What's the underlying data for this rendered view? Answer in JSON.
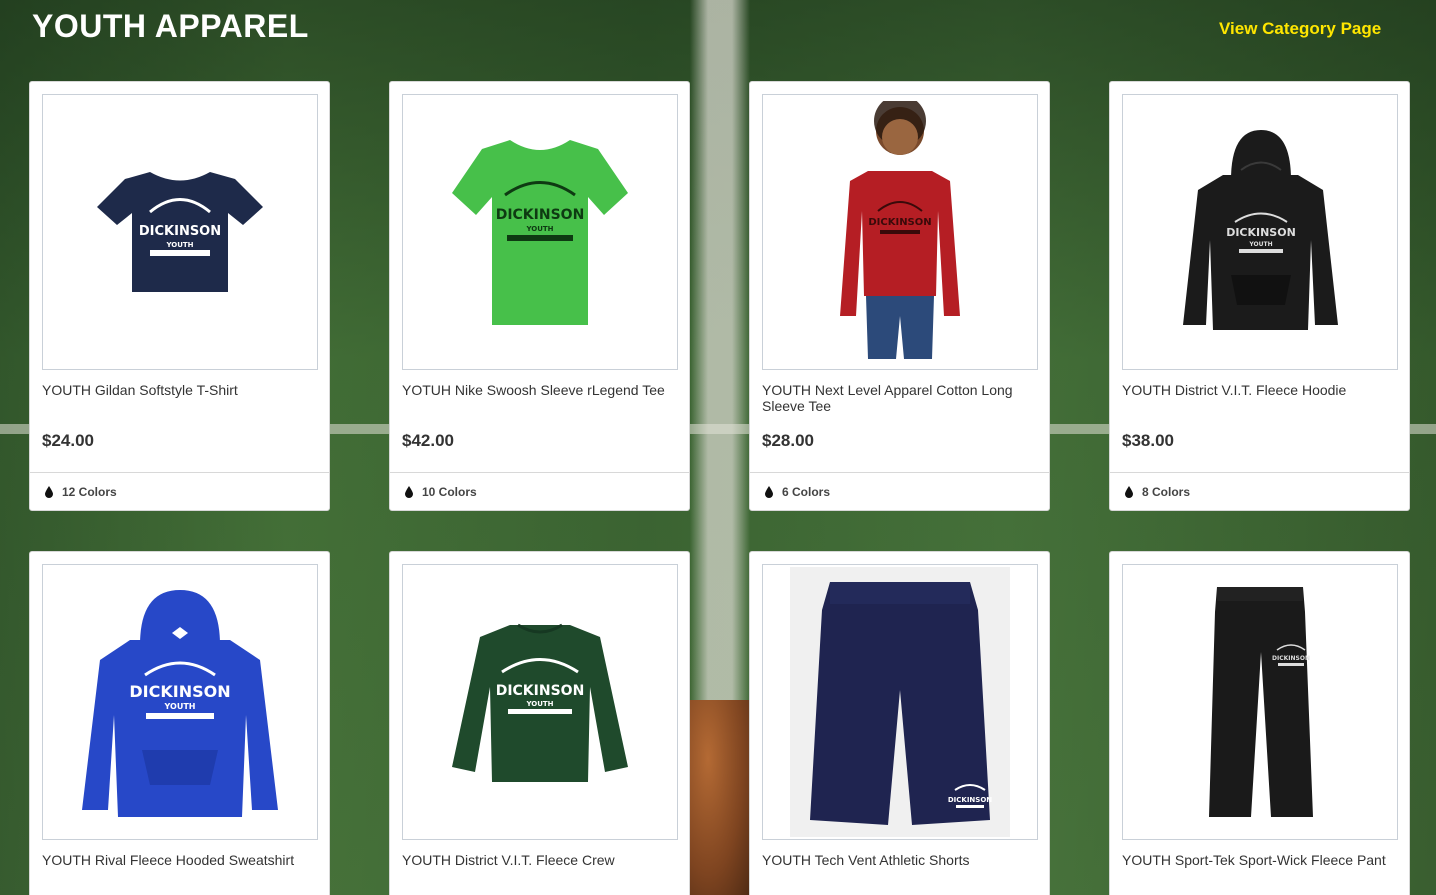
{
  "header": {
    "title": "YOUTH APPAREL",
    "category_link": "View Category Page"
  },
  "colors": {
    "link": "#ffe600",
    "price": "#333333"
  },
  "products": [
    {
      "name": "YOUTH Gildan Softstyle T-Shirt",
      "price": "$24.00",
      "colors_label": "12 Colors",
      "garment": "tshirt",
      "garment_color": "#1e2a4a",
      "print": "DICKINSON YOUTH FOOTBALL LEAGUE"
    },
    {
      "name": "YOTUH Nike Swoosh Sleeve rLegend Tee",
      "price": "$42.00",
      "colors_label": "10 Colors",
      "garment": "tshirt",
      "garment_color": "#47c04a",
      "print": "DICKINSON YOUTH FOOTBALL LEAGUE"
    },
    {
      "name": "YOUTH Next Level Apparel Cotton Long Sleeve Tee",
      "price": "$28.00",
      "colors_label": "6 Colors",
      "garment": "longsleeve-model",
      "garment_color": "#b51e24",
      "print": "DICKINSON YOUTH FOOTBALL LEAGUE"
    },
    {
      "name": "YOUTH District V.I.T. Fleece Hoodie",
      "price": "$38.00",
      "colors_label": "8 Colors",
      "garment": "hoodie",
      "garment_color": "#1b1b1b",
      "print": "DICKINSON YOUTH FOOTBALL LEAGUE"
    },
    {
      "name": "YOUTH Rival Fleece Hooded Sweatshirt",
      "price": "",
      "colors_label": "",
      "garment": "hoodie",
      "garment_color": "#2748c8",
      "print": "DICKINSON YOUTH FOOTBALL LEAGUE"
    },
    {
      "name": "YOUTH District V.I.T. Fleece Crew",
      "price": "",
      "colors_label": "",
      "garment": "crew",
      "garment_color": "#1f4a2c",
      "print": "DICKINSON YOUTH FOOTBALL LEAGUE"
    },
    {
      "name": "YOUTH Tech Vent Athletic Shorts",
      "price": "",
      "colors_label": "",
      "garment": "shorts",
      "garment_color": "#1f2450",
      "print": "DICKINSON YOUTH FOOTBALL LEAGUE"
    },
    {
      "name": "YOUTH Sport-Tek Sport-Wick Fleece Pant",
      "price": "",
      "colors_label": "",
      "garment": "pants",
      "garment_color": "#1a1a1a",
      "print": "DICKINSON YOUTH FOOTBALL LEAGUE"
    }
  ]
}
